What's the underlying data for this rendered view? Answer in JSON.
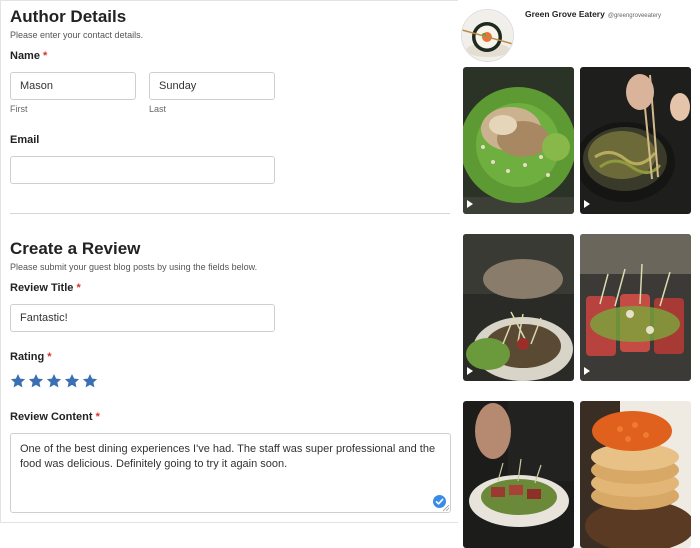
{
  "author": {
    "title": "Author Details",
    "subtitle": "Please enter your contact details.",
    "name_label": "Name",
    "required_mark": "*",
    "first_value": "Mason",
    "first_hint": "First",
    "last_value": "Sunday",
    "last_hint": "Last",
    "email_label": "Email",
    "email_value": ""
  },
  "review": {
    "title": "Create a Review",
    "subtitle": "Please submit your guest blog posts by using the fields below.",
    "review_title_label": "Review Title",
    "review_title_value": "Fantastic!",
    "rating_label": "Rating",
    "rating": 5,
    "rating_max": 5,
    "content_label": "Review Content",
    "content_value": "One of the best dining experiences I've had. The staff was super professional and the food was delicious. Definitely going to try it again soon."
  },
  "feed": {
    "account_name": "Green Grove Eatery",
    "account_handle": "@greengroveeatery",
    "tiles": [
      {
        "name": "wrap-plate",
        "video": true
      },
      {
        "name": "wok-noodles",
        "video": true
      },
      {
        "name": "sprout-bowl",
        "video": true
      },
      {
        "name": "seared-tuna",
        "video": true
      },
      {
        "name": "steak-salad",
        "video": false
      },
      {
        "name": "roe-pancakes",
        "video": false
      }
    ]
  },
  "colors": {
    "star": "#3a6fb3",
    "required": "#d9302c",
    "accent": "#3b8be6"
  }
}
